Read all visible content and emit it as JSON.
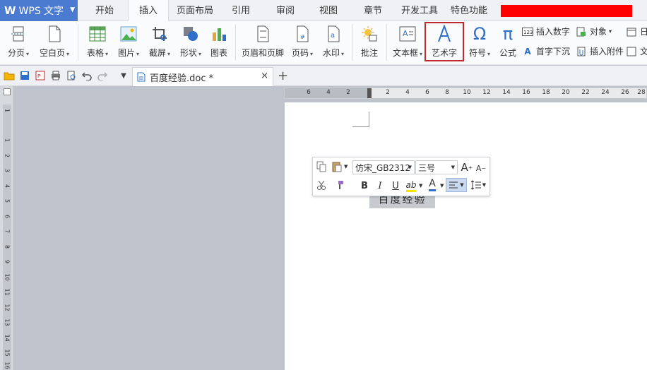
{
  "menubar": {
    "app_logo": "W",
    "app_name": "WPS 文字",
    "items": [
      "开始",
      "插入",
      "页面布局",
      "引用",
      "审阅",
      "视图",
      "章节",
      "开发工具",
      "特色功能"
    ],
    "active_index": 1,
    "redacted_color": "#ff0000"
  },
  "ribbon": {
    "buttons": [
      {
        "label": "分页",
        "icon": "page-break-icon",
        "dropdown": true
      },
      {
        "label": "空白页",
        "icon": "blank-page-icon",
        "dropdown": true
      },
      {
        "label": "表格",
        "icon": "table-icon",
        "dropdown": true
      },
      {
        "label": "图片",
        "icon": "picture-icon",
        "dropdown": true
      },
      {
        "label": "截屏",
        "icon": "screenshot-icon",
        "dropdown": true
      },
      {
        "label": "形状",
        "icon": "shapes-icon",
        "dropdown": true
      },
      {
        "label": "图表",
        "icon": "chart-icon",
        "dropdown": false
      },
      {
        "label": "页眉和页脚",
        "icon": "header-footer-icon",
        "dropdown": false
      },
      {
        "label": "页码",
        "icon": "page-number-icon",
        "dropdown": true
      },
      {
        "label": "水印",
        "icon": "watermark-icon",
        "dropdown": true
      },
      {
        "label": "批注",
        "icon": "comment-icon",
        "dropdown": false
      },
      {
        "label": "文本框",
        "icon": "textbox-icon",
        "dropdown": true
      },
      {
        "label": "艺术字",
        "icon": "wordart-icon",
        "dropdown": false,
        "highlighted": true
      },
      {
        "label": "符号",
        "icon": "omega-icon",
        "dropdown": true
      },
      {
        "label": "公式",
        "icon": "pi-icon",
        "dropdown": false
      }
    ],
    "small": {
      "insert_number": "插入数字",
      "object": "对象",
      "drop_cap": "首字下沉",
      "attachment": "插入附件",
      "cut_1": "日",
      "cut_2": "文"
    },
    "highlight_color": "#c0282e",
    "accent_color": "#2f6fc7"
  },
  "quickaccess": {
    "icons": [
      "open-icon",
      "save-icon",
      "export-pdf-icon",
      "print-icon",
      "print-preview-icon",
      "undo-icon",
      "redo-icon",
      "customize-dropdown-icon"
    ]
  },
  "tab": {
    "filename": "百度经验.doc *",
    "close": "×",
    "new": "+"
  },
  "hruler": {
    "ticks": [
      "6",
      "4",
      "2",
      "",
      "2",
      "4",
      "6",
      "8",
      "10",
      "12",
      "14",
      "16",
      "18",
      "20",
      "22",
      "24",
      "26",
      "28"
    ]
  },
  "vruler": {
    "ticks": [
      "1",
      "",
      "1",
      "2",
      "3",
      "4",
      "5",
      "6",
      "7",
      "8",
      "9",
      "10",
      "11",
      "12",
      "13",
      "14",
      "15",
      "16"
    ]
  },
  "document": {
    "selected_text": "百度经验"
  },
  "minitoolbar": {
    "font_name": "仿宋_GB2312",
    "font_size": "三号",
    "grow": "A",
    "shrink": "A",
    "bold": "B",
    "italic": "I",
    "underline": "U",
    "font_color_letter": "A",
    "highlight_letter": "ab"
  }
}
